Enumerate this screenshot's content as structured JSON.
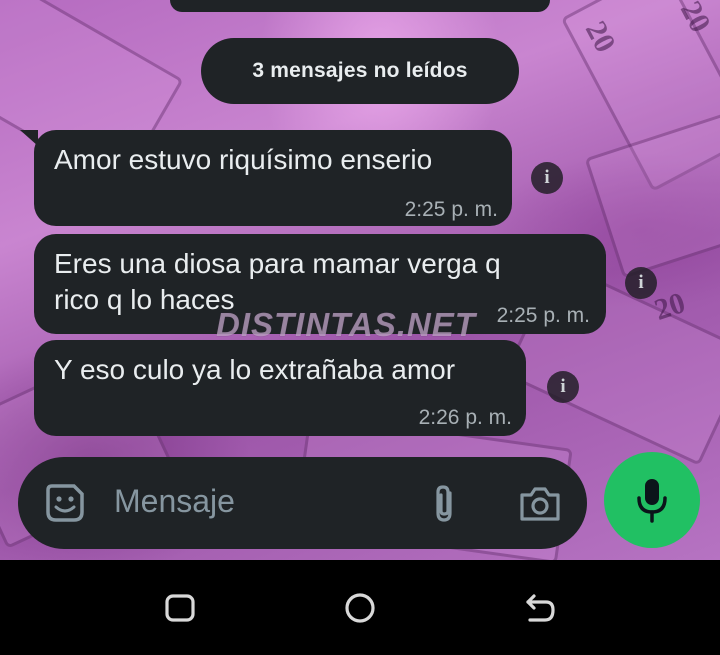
{
  "unread_banner": "3 mensajes no leídos",
  "messages": [
    {
      "text": "Amor estuvo riquísimo enserio",
      "time": "2:25 p. m."
    },
    {
      "line1": "Eres una diosa para mamar verga q",
      "line2": "rico q lo haces",
      "time": "2:25 p. m."
    },
    {
      "text": "Y eso culo ya lo extrañaba amor",
      "time": "2:26 p. m."
    }
  ],
  "watermark": "DISTINTAS.NET",
  "wallpaper_numbers": [
    "20",
    "20",
    "20"
  ],
  "info_glyph": "i",
  "composer": {
    "placeholder": "Mensaje"
  },
  "colors": {
    "bubble": "#1f2326",
    "accent": "#21c063",
    "text": "#e9edef",
    "meta": "#a8b0b5"
  },
  "icons": [
    "sticker-icon",
    "attach-icon",
    "camera-icon",
    "mic-icon",
    "recents-icon",
    "home-icon",
    "back-icon"
  ]
}
